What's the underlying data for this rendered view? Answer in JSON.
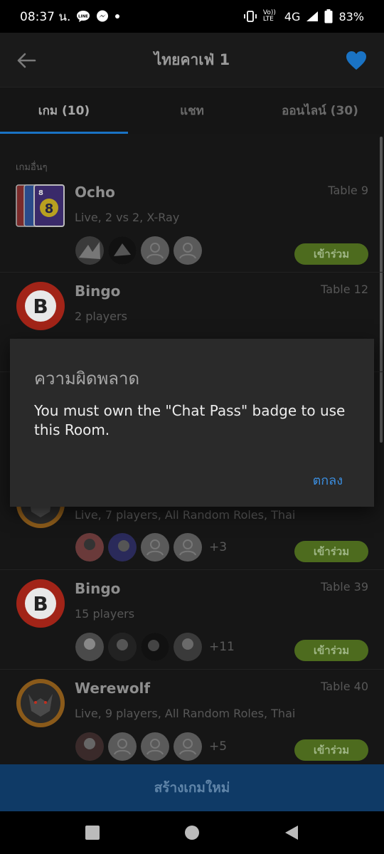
{
  "status_bar": {
    "time": "08:37 น.",
    "network": "4G",
    "volte": "Vo)) LTE",
    "battery": "83%",
    "icons": [
      "line-icon",
      "messenger-icon",
      "dot-icon",
      "vibrate-icon",
      "signal-icon",
      "battery-icon"
    ]
  },
  "app_bar": {
    "title": "ไทยคาเฟ่ 1",
    "accent_color": "#1a73c4"
  },
  "tabs": [
    {
      "label": "เกม (10)",
      "active": true
    },
    {
      "label": "แชท",
      "active": false
    },
    {
      "label": "ออนไลน์ (30)",
      "active": false
    }
  ],
  "list": {
    "section_label": "เกมอื่นๆ",
    "games": [
      {
        "name": "Ocho",
        "table": "Table 9",
        "desc": "Live, 2 vs 2, X-Ray",
        "more": "",
        "join": "เข้าร่วม"
      },
      {
        "name": "Bingo",
        "table": "Table 12",
        "desc": "2 players",
        "more": "",
        "join": ""
      },
      {
        "name": "",
        "table": "",
        "desc": "Live, 7 players, All Random Roles, Thai",
        "more": "+3",
        "join": "เข้าร่วม"
      },
      {
        "name": "Bingo",
        "table": "Table 39",
        "desc": "15 players",
        "more": "+11",
        "join": "เข้าร่วม"
      },
      {
        "name": "Werewolf",
        "table": "Table 40",
        "desc": "Live, 9 players, All Random Roles, Thai",
        "more": "+5",
        "join": "เข้าร่วม"
      }
    ]
  },
  "create_button": "สร้างเกมใหม่",
  "dialog": {
    "title": "ความผิดพลาด",
    "message": "You must own the \"Chat Pass\" badge to use this Room.",
    "ok_label": "ตกลง"
  }
}
